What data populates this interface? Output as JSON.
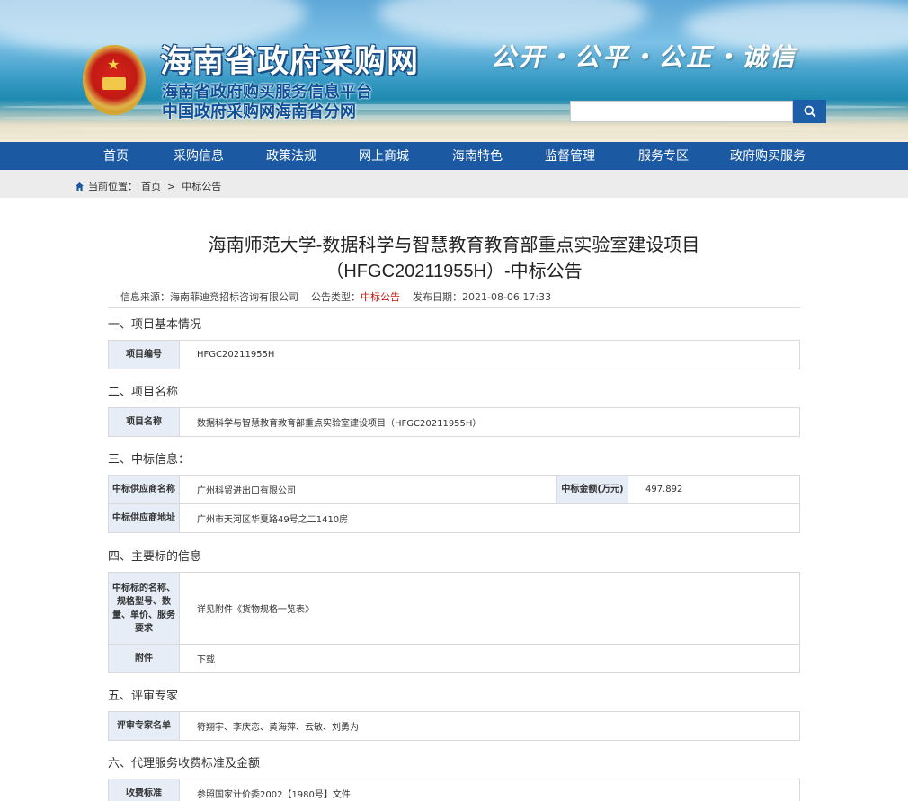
{
  "header": {
    "site_title": "海南省政府采购网",
    "subtitle_1": "海南省政府购买服务信息平台",
    "subtitle_2": "中国政府采购网海南省分网",
    "slogan": "公开・公平・公正・诚信",
    "search": {
      "value": "",
      "placeholder": ""
    },
    "search_icon": "search-icon"
  },
  "nav": {
    "items": [
      {
        "label": "首页"
      },
      {
        "label": "采购信息"
      },
      {
        "label": "政策法规"
      },
      {
        "label": "网上商城"
      },
      {
        "label": "海南特色"
      },
      {
        "label": "监督管理"
      },
      {
        "label": "服务专区"
      },
      {
        "label": "政府购买服务"
      }
    ]
  },
  "breadcrumb": {
    "prefix": "当前位置：",
    "home": "首页",
    "sep": ">",
    "current": "中标公告"
  },
  "article": {
    "title_line1": "海南师范大学-数据科学与智慧教育教育部重点实验室建设项目",
    "title_line2": "（HFGC20211955H）-中标公告",
    "meta": {
      "source_label": "信息来源：",
      "source": "海南菲迪竞招标咨询有限公司",
      "type_label": "公告类型：",
      "type": "中标公告",
      "date_label": "发布日期：",
      "date": "2021-08-06 17:33"
    },
    "sections": [
      {
        "heading": "一、项目基本情况"
      },
      {
        "heading": "二、项目名称"
      },
      {
        "heading": "三、中标信息："
      },
      {
        "heading": "四、主要标的信息"
      },
      {
        "heading": "五、评审专家"
      },
      {
        "heading": "六、代理服务收费标准及金额"
      }
    ],
    "project_no": {
      "label": "项目编号",
      "value": "HFGC20211955H"
    },
    "project_name": {
      "label": "项目名称",
      "value": "数据科学与智慧教育教育部重点实验室建设项目（HFGC20211955H）"
    },
    "winner": {
      "supplier_label": "中标供应商名称",
      "supplier": "广州科贸进出口有限公司",
      "amount_label": "中标金额(万元)",
      "amount": "497.892",
      "address_label": "中标供应商地址",
      "address": "广州市天河区华夏路49号之二1410房"
    },
    "items": {
      "name_label": "中标标的名称、规格型号、数量、单价、服务要求",
      "name_value": "详见附件《货物规格一览表》",
      "attach_label": "附件",
      "attach_value": "下载"
    },
    "experts": {
      "label": "评审专家名单",
      "value": "符翔宇、李庆恋、黄海萍、云敏、刘勇为"
    },
    "fee": {
      "label": "收费标准",
      "value": "参照国家计价委2002【1980号】文件"
    }
  }
}
